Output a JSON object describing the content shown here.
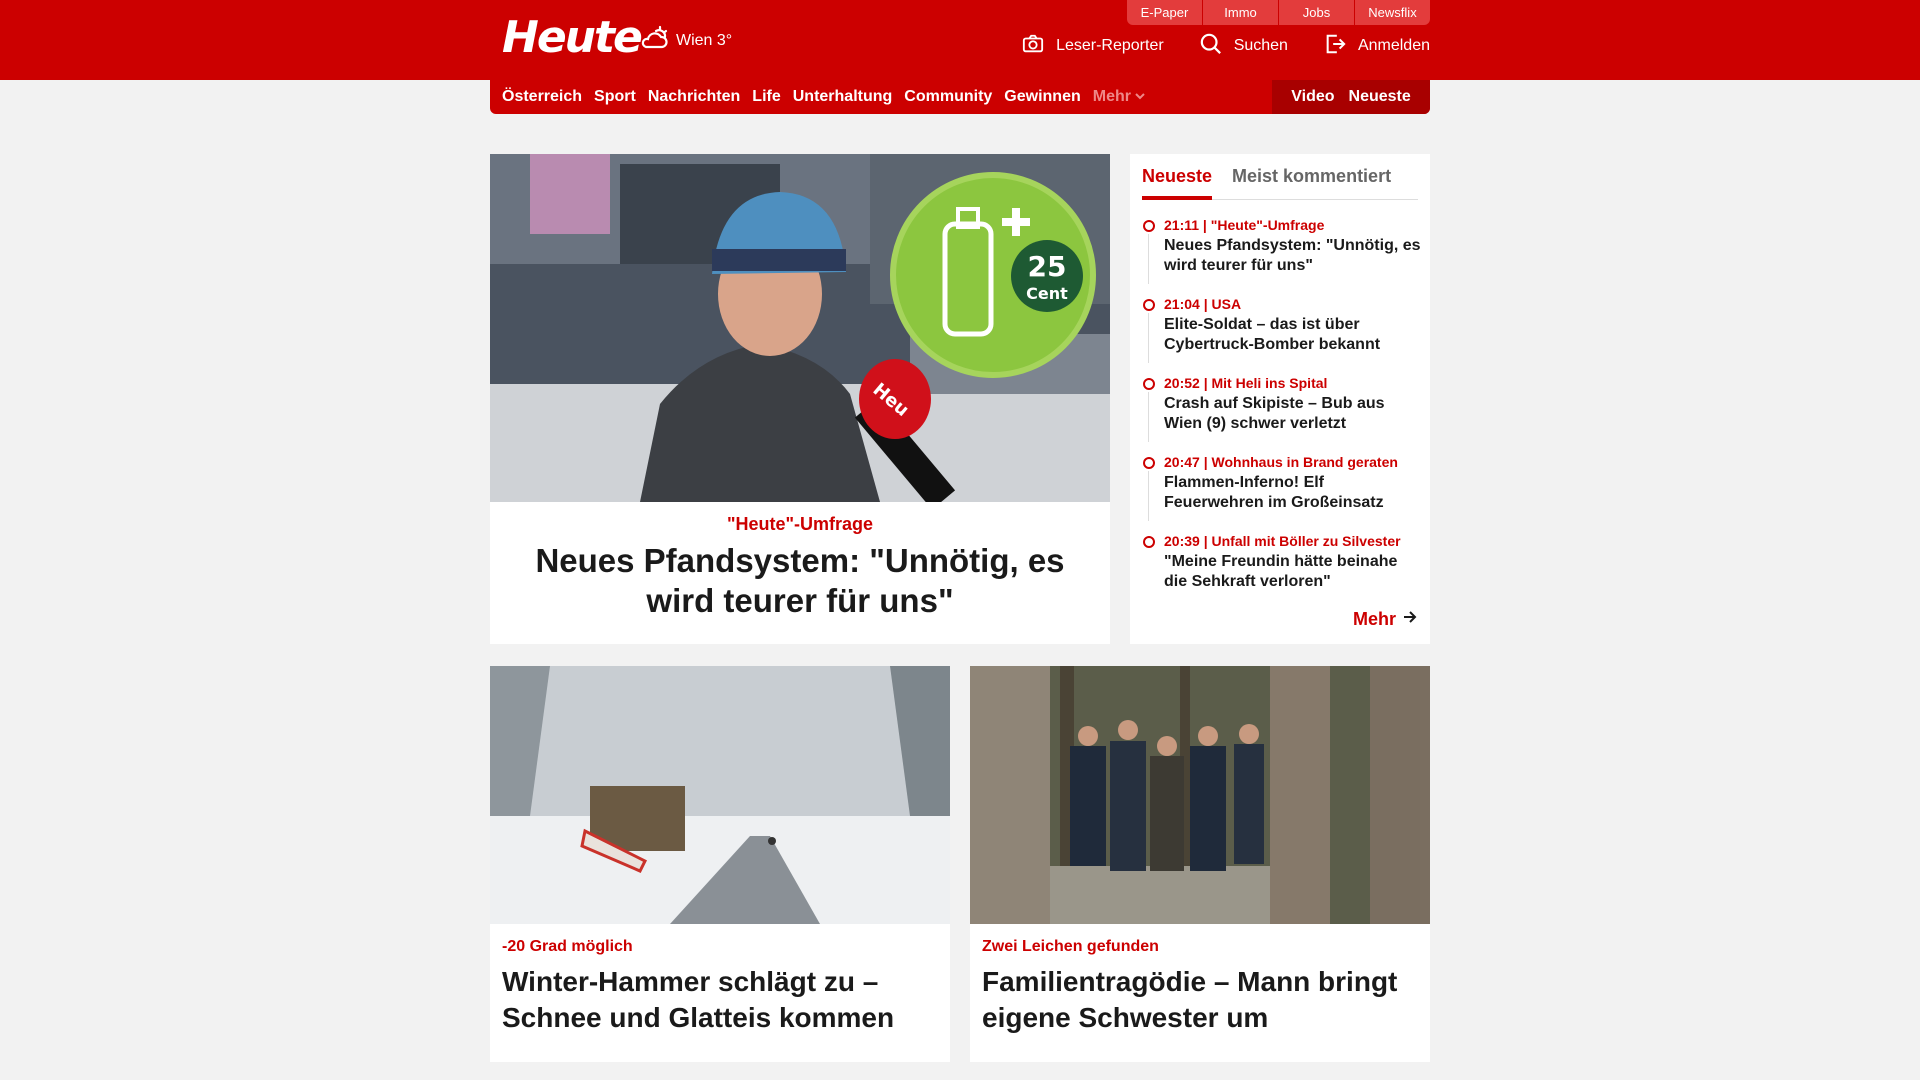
{
  "header": {
    "logo": "Heute",
    "weather": "Wien 3°",
    "utility_links": [
      "E-Paper",
      "Immo",
      "Jobs",
      "Newsflix"
    ],
    "actions": {
      "reporter": "Leser-Reporter",
      "search": "Suchen",
      "login": "Anmelden"
    }
  },
  "nav": {
    "items": [
      "Österreich",
      "Sport",
      "Nachrichten",
      "Life",
      "Unterhaltung",
      "Community",
      "Gewinnen"
    ],
    "more": "Mehr",
    "video": "Video",
    "latest": "Neueste"
  },
  "hero": {
    "badge_number": "25",
    "badge_unit": "Cent",
    "mic_text": "Heu",
    "kicker": "\"Heute\"-Umfrage",
    "title": "Neues Pfandsystem: \"Unnötig, es wird teurer für uns\""
  },
  "sidebar": {
    "tabs": [
      "Neueste",
      "Meist kommentiert"
    ],
    "items": [
      {
        "meta": "21:11 | \"Heute\"-Umfrage",
        "title": "Neues Pfandsystem: \"Unnötig, es wird teurer für uns\""
      },
      {
        "meta": "21:04 | USA",
        "title": "Elite-Soldat – das ist über Cybertruck-Bomber bekannt"
      },
      {
        "meta": "20:52 | Mit Heli ins Spital",
        "title": "Crash auf Skipiste – Bub aus Wien (9) schwer verletzt"
      },
      {
        "meta": "20:47 | Wohnhaus in Brand geraten",
        "title": "Flammen-Inferno! Elf Feuerwehren im Großeinsatz"
      },
      {
        "meta": "20:39 | Unfall mit Böller zu Silvester",
        "title": "\"Meine Freundin hätte beinahe die Sehkraft verloren\""
      }
    ],
    "more": "Mehr"
  },
  "cards": [
    {
      "kicker": "-20 Grad möglich",
      "title": "Winter-Hammer schlägt zu – Schnee und Glatteis kommen"
    },
    {
      "kicker": "Zwei Leichen gefunden",
      "title": "Familientragödie – Mann bringt eigene Schwester um"
    }
  ],
  "colors": {
    "brand": "#cc0000",
    "brand_dark": "#a80000",
    "utility": "#e33c3c"
  }
}
